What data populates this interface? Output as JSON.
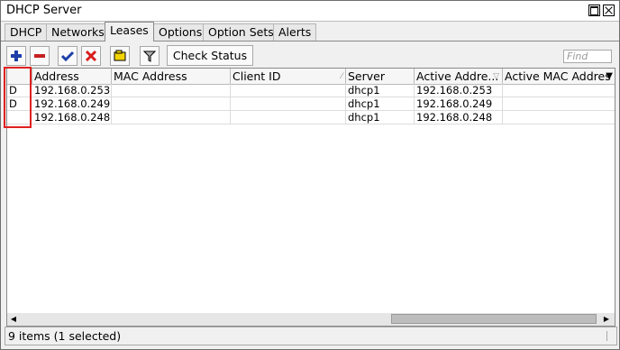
{
  "window": {
    "title": "DHCP Server"
  },
  "tabs": [
    {
      "label": "DHCP",
      "active": false
    },
    {
      "label": "Networks",
      "active": false
    },
    {
      "label": "Leases",
      "active": true
    },
    {
      "label": "Options",
      "active": false
    },
    {
      "label": "Option Sets",
      "active": false
    },
    {
      "label": "Alerts",
      "active": false
    }
  ],
  "toolbar": {
    "add_icon": "plus-icon",
    "remove_icon": "minus-icon",
    "enable_icon": "check-icon",
    "disable_icon": "x-icon",
    "comment_icon": "note-icon",
    "filter_icon": "filter-icon",
    "check_status_label": "Check Status",
    "find_placeholder": "Find"
  },
  "table": {
    "columns": [
      "",
      "Address",
      "MAC Address",
      "Client ID",
      "Server",
      "Active Addre...",
      "Active MAC Addres"
    ],
    "rows": [
      {
        "flag": "D",
        "address": "192.168.0.253",
        "mac": "",
        "client_id": "",
        "server": "dhcp1",
        "active_address": "192.168.0.253",
        "active_mac": ""
      },
      {
        "flag": "D",
        "address": "192.168.0.249",
        "mac": "",
        "client_id": "",
        "server": "dhcp1",
        "active_address": "192.168.0.249",
        "active_mac": ""
      },
      {
        "flag": "",
        "address": "192.168.0.248",
        "mac": "",
        "client_id": "",
        "server": "dhcp1",
        "active_address": "192.168.0.248",
        "active_mac": ""
      }
    ]
  },
  "status": {
    "text": "9 items (1 selected)"
  },
  "colors": {
    "highlight": "#e02020",
    "add_icon": "#1e3fa8",
    "remove_icon": "#c62020",
    "check_icon": "#1e3fa8",
    "x_icon": "#d81c1c",
    "note_icon": "#f2d400"
  }
}
